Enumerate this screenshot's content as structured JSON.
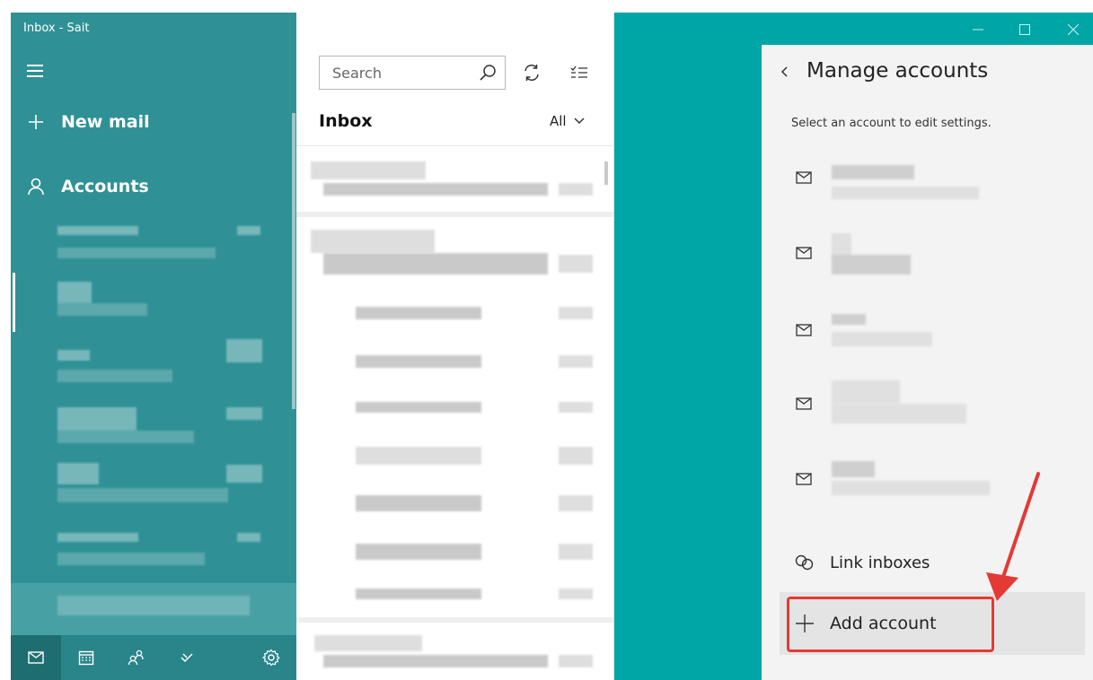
{
  "window": {
    "title": "Inbox - Sait",
    "caption_buttons": [
      "minimize-icon",
      "maximize-icon",
      "close-icon"
    ]
  },
  "nav": {
    "new_mail_label": "New mail",
    "accounts_label": "Accounts",
    "bottom_icons": [
      "mail-icon",
      "calendar-icon",
      "people-icon",
      "todo-icon",
      "settings-icon"
    ]
  },
  "list": {
    "search_placeholder": "Search",
    "folder_title": "Inbox",
    "filter_label": "All"
  },
  "panel": {
    "title": "Manage accounts",
    "subtitle": "Select an account to edit settings.",
    "link_inboxes_label": "Link inboxes",
    "add_account_label": "Add account"
  },
  "colors": {
    "nav_bg": "#2f9196",
    "teal_bg": "#00a5a5",
    "highlight": "#e53935"
  }
}
